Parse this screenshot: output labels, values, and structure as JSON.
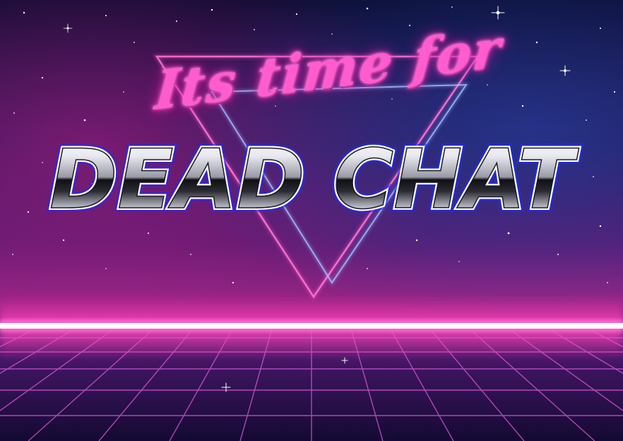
{
  "image": {
    "subtitle": "Its time for",
    "title": "DEAD CHAT",
    "colors": {
      "sky_top": "#0a0b2e",
      "sky_mid": "#3a0f55",
      "horizon_glow": "#ff2fa8",
      "horizon_line": "#ffffff",
      "grid": "#d14cd6",
      "neon_pink": "#ff5ccf",
      "neon_blue": "#7a9bff",
      "chrome_light": "#ffffff",
      "chrome_dark": "#1a1a1a"
    }
  }
}
